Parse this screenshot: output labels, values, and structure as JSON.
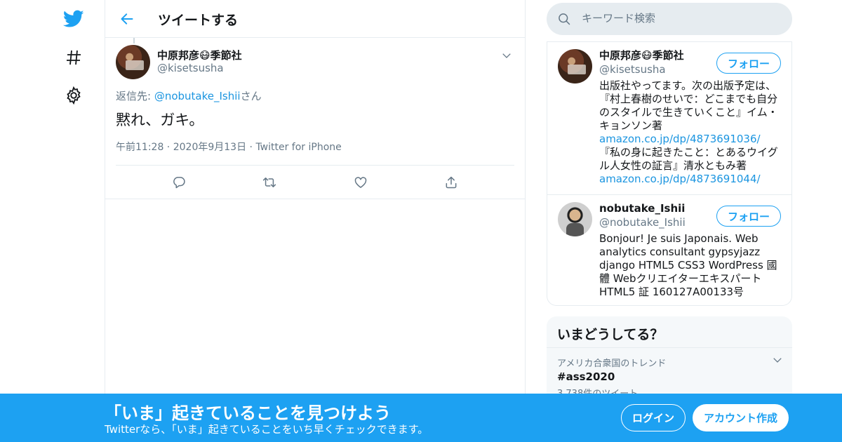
{
  "colors": {
    "accent": "#1da1f2",
    "link": "#1b95e0",
    "muted": "#657786",
    "border": "#e6ecf0",
    "banner": "#1da1f2"
  },
  "nav": {
    "items": [
      {
        "icon": "twitter-bird-icon"
      },
      {
        "icon": "hashtag-icon"
      },
      {
        "icon": "gear-icon"
      }
    ]
  },
  "header": {
    "title": "ツイートする",
    "back_icon": "back-arrow-icon"
  },
  "tweet": {
    "name": "中原邦彦😷季節社",
    "handle": "@kisetsusha",
    "reply_prefix": "返信先: ",
    "reply_mention": "@nobutake_Ishii",
    "reply_suffix": "さん",
    "text": "黙れ、ガキ。",
    "time": "午前11:28",
    "date": "2020年9月13日",
    "source": "Twitter for iPhone",
    "actions": [
      "reply-icon",
      "retweet-icon",
      "like-icon",
      "share-icon"
    ]
  },
  "search": {
    "placeholder": "キーワード検索"
  },
  "users": [
    {
      "name": "中原邦彦😷季節社",
      "handle": "@kisetsusha",
      "follow_label": "フォロー",
      "bio_1": "出版社やってます。次の出版予定は、『村上春樹のせいで：どこまでも自分のスタイルで生きていくこと』イム・キョンソン著",
      "link_1": "amazon.co.jp/dp/4873691036/",
      "bio_2": " 『私の身に起きたこと：とあるウイグル人女性の証言』清水ともみ著",
      "link_2": "amazon.co.jp/dp/4873691044/"
    },
    {
      "name": "nobutake_Ishii",
      "handle": "@nobutake_Ishii",
      "follow_label": "フォロー",
      "bio": "Bonjour! Je suis Japonais. Web analytics consultant gypsyjazz django HTML5 CSS3 WordPress 國體 Webクリエイターエキスパート HTML5 証 160127A00133号"
    }
  ],
  "trends": {
    "title": "いまどうしてる？",
    "items": [
      {
        "context": "アメリカ合衆国のトレンド",
        "name": "#ass2020",
        "count": "3,738件のツイート"
      }
    ]
  },
  "banner": {
    "title": "「いま」起きていることを見つけよう",
    "subtitle": "Twitterなら、「いま」起きていることをいち早くチェックできます。",
    "login_label": "ログイン",
    "signup_label": "アカウント作成"
  }
}
